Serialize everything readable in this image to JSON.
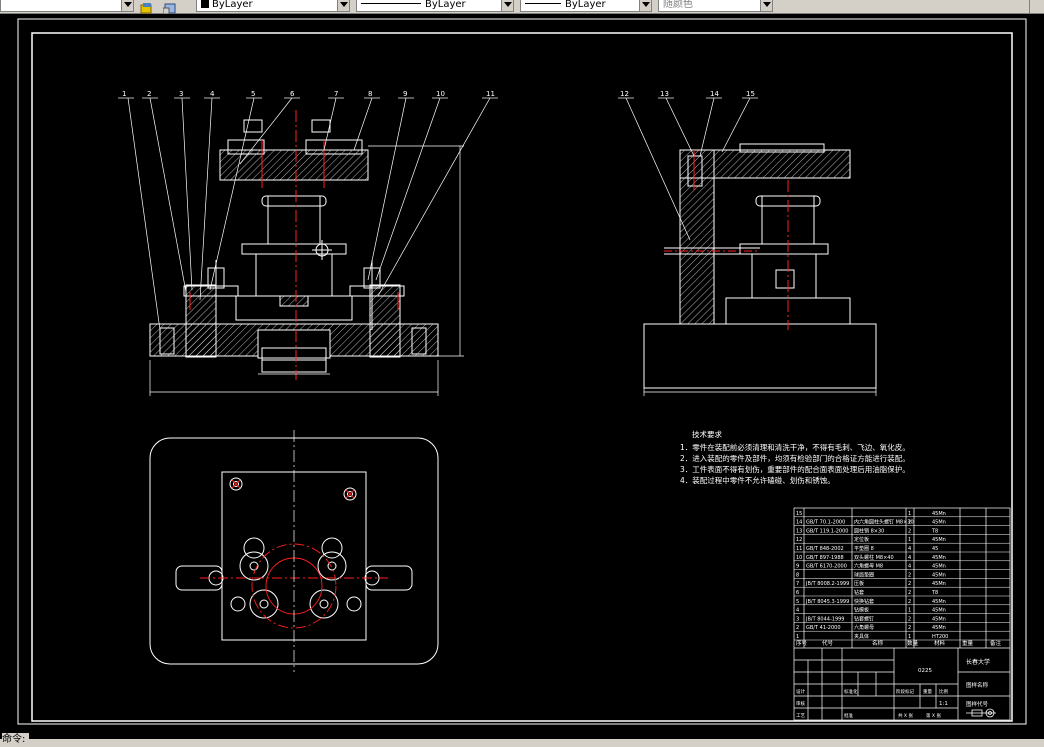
{
  "toolbar": {
    "layer_color_label": "ByLayer",
    "linetype_label": "ByLayer",
    "lineweight_label": "ByLayer",
    "plotstyle_label": "随颜色"
  },
  "drawing": {
    "balloons_front": [
      "1",
      "2",
      "3",
      "4",
      "5",
      "6",
      "7",
      "8",
      "9",
      "10",
      "11"
    ],
    "balloons_side": [
      "12",
      "13",
      "14",
      "15"
    ],
    "notes_title": "技术要求",
    "notes": [
      "1．零件在装配前必须清理和清洗干净，不得有毛刺、飞边、氧化皮。",
      "2．进入装配的零件及部件，均须有检验部门的合格证方能进行装配。",
      "3．工件表面不得有划伤，重要部件的配合面表面处理后用油脂保护。",
      "4．装配过程中零件不允许磕碰、划伤和锈蚀。"
    ],
    "title_block": {
      "drawing_no": "0225",
      "school": "长春大学",
      "name_cell": "图样名称",
      "code_cell": "图样代号",
      "scale": "1:1",
      "material_header": "材料",
      "qty_header": "数量",
      "designer_label": "设计",
      "check_label": "审核",
      "process_label": "工艺",
      "std_label": "标准化",
      "approve_label": "批准",
      "stage_label": "阶段标记",
      "weight_label": "重量",
      "ratio_label": "比例",
      "sheet_label": "共 X 张",
      "sheet_of_label": "第 X 张"
    },
    "bom_rows": [
      {
        "no": "15",
        "code": "",
        "name": "",
        "qty": "1",
        "mat": "45Mn"
      },
      {
        "no": "14",
        "code": "GB/T 70.1-2000",
        "name": "内六角圆柱头螺钉 M8×30",
        "qty": "2",
        "mat": "45Mn"
      },
      {
        "no": "13",
        "code": "GB/T 119.1-2000",
        "name": "圆柱销 8×30",
        "qty": "2",
        "mat": "T8"
      },
      {
        "no": "12",
        "code": "",
        "name": "定位板",
        "qty": "1",
        "mat": "45Mn"
      },
      {
        "no": "11",
        "code": "GB/T 848-2002",
        "name": "平垫圈 8",
        "qty": "4",
        "mat": "45"
      },
      {
        "no": "10",
        "code": "GB/T 897-1988",
        "name": "双头螺柱 M8×40",
        "qty": "4",
        "mat": "45Mn"
      },
      {
        "no": "9",
        "code": "GB/T 6170-2000",
        "name": "六角螺母 M8",
        "qty": "4",
        "mat": "45Mn"
      },
      {
        "no": "8",
        "code": "",
        "name": "球面垫圈",
        "qty": "2",
        "mat": "45Mn"
      },
      {
        "no": "7",
        "code": "JB/T 8008.2-1999",
        "name": "压板",
        "qty": "2",
        "mat": "45Mn"
      },
      {
        "no": "6",
        "code": "",
        "name": "钻套",
        "qty": "2",
        "mat": "T8"
      },
      {
        "no": "5",
        "code": "JB/T 8045.3-1999",
        "name": "快换钻套",
        "qty": "2",
        "mat": "45Mn"
      },
      {
        "no": "4",
        "code": "",
        "name": "钻模板",
        "qty": "1",
        "mat": "45Mn"
      },
      {
        "no": "3",
        "code": "JB/T 8044-1999",
        "name": "钻套螺钉",
        "qty": "2",
        "mat": "45Mn"
      },
      {
        "no": "2",
        "code": "GB/T 41-2000",
        "name": "六角螺母",
        "qty": "2",
        "mat": "45Mn"
      },
      {
        "no": "1",
        "code": "",
        "name": "夹具体",
        "qty": "1",
        "mat": "HT200"
      }
    ],
    "bom_header": {
      "no": "序号",
      "code": "代号",
      "name": "名称",
      "qty": "数量",
      "mat": "材料",
      "weight": "重量",
      "note": "备注"
    }
  },
  "cmdline": {
    "prompt": "命令:"
  }
}
